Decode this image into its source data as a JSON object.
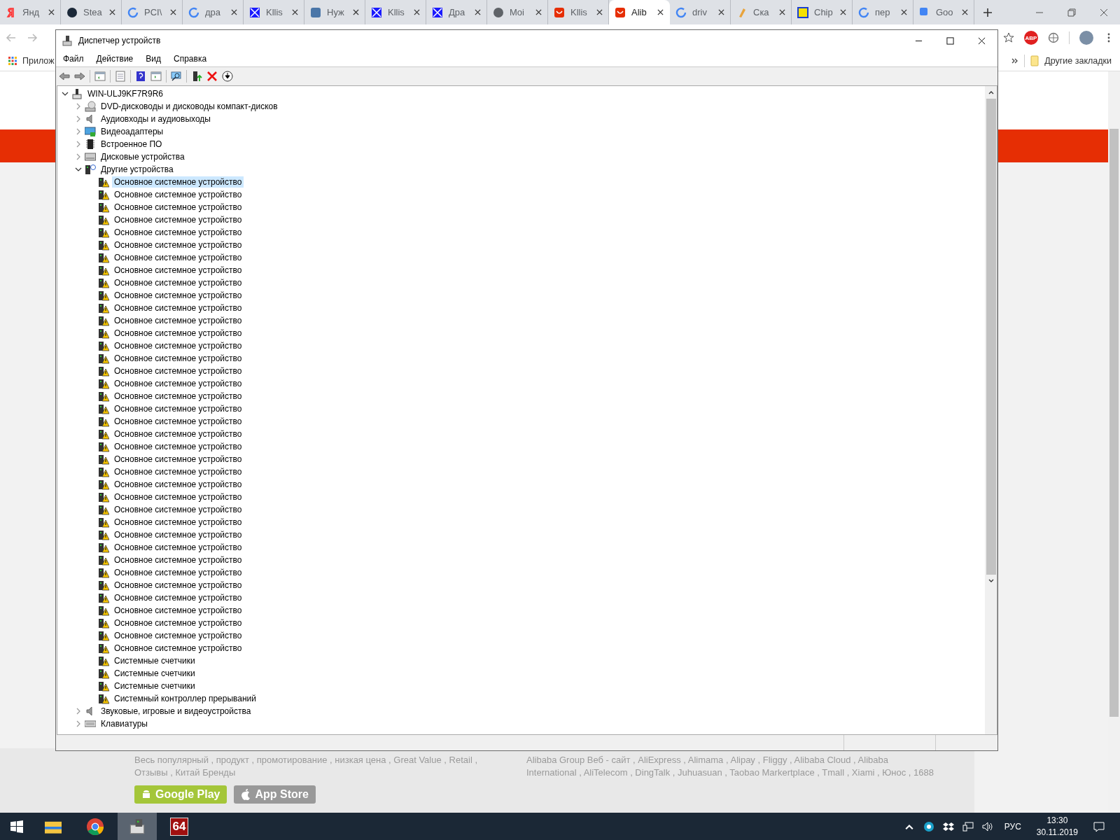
{
  "browser": {
    "tabs": [
      {
        "label": "Янд",
        "selected": false,
        "kind": "yandex"
      },
      {
        "label": "Stea",
        "selected": false,
        "kind": "steam"
      },
      {
        "label": "PCI\\",
        "selected": false,
        "kind": "google"
      },
      {
        "label": "дра",
        "selected": false,
        "kind": "google"
      },
      {
        "label": "Kllis",
        "selected": false,
        "kind": "cross"
      },
      {
        "label": "Нуж",
        "selected": false,
        "kind": "vk"
      },
      {
        "label": "Kllis",
        "selected": false,
        "kind": "cross"
      },
      {
        "label": "Дра",
        "selected": false,
        "kind": "cross"
      },
      {
        "label": "Moi",
        "selected": false,
        "kind": "globe"
      },
      {
        "label": "Kllis",
        "selected": false,
        "kind": "bag"
      },
      {
        "label": "Alib",
        "selected": true,
        "kind": "bag"
      },
      {
        "label": "driv",
        "selected": false,
        "kind": "google"
      },
      {
        "label": "Ска",
        "selected": false,
        "kind": "pencil"
      },
      {
        "label": "Chip",
        "selected": false,
        "kind": "chip"
      },
      {
        "label": "пер",
        "selected": false,
        "kind": "google"
      },
      {
        "label": "Goo",
        "selected": false,
        "kind": "translate"
      }
    ],
    "extension_badge": "ABP",
    "bookmarks": {
      "apps_label": "Прилож",
      "folder_label": "Другие закладки"
    },
    "page": {
      "left_links": [
        "Весь популярный , продукт , промотирование , низкая цена , Great Value , Retail ,",
        "Отзывы , Китай Бренды"
      ],
      "right_links": [
        "Alibaba Group Веб - сайт , AliExpress , Alimama , Alipay , Fliggy , Alibaba Cloud , Alibaba",
        "International , AliTelecom , DingTalk , Juhuasuan , Taobao Markertplace , Tmall , Xiami , Юнос , 1688"
      ],
      "store_buttons": [
        "Google Play",
        "App Store"
      ]
    }
  },
  "window": {
    "title": "Диспетчер устройств",
    "menu": [
      "Файл",
      "Действие",
      "Вид",
      "Справка"
    ],
    "tree": {
      "label": "WIN-ULJ9KF7R9R6",
      "kind": "computer",
      "expanded": true,
      "selected": false,
      "children": [
        {
          "label": "DVD-дисководы и дисководы компакт-дисков",
          "kind": "dvd",
          "expanded": false,
          "selected": false
        },
        {
          "label": "Аудиовходы и аудиовыходы",
          "kind": "audio",
          "expanded": false,
          "selected": false
        },
        {
          "label": "Видеоадаптеры",
          "kind": "display",
          "expanded": false,
          "selected": false
        },
        {
          "label": "Встроенное ПО",
          "kind": "firmware",
          "expanded": false,
          "selected": false
        },
        {
          "label": "Дисковые устройства",
          "kind": "disk",
          "expanded": false,
          "selected": false
        },
        {
          "label": "Другие устройства",
          "kind": "unknown",
          "expanded": true,
          "selected": false,
          "children": [
            {
              "label": "Основное системное устройство",
              "kind": "warning",
              "selected": true
            },
            {
              "label": "Основное системное устройство",
              "kind": "warning",
              "selected": false
            },
            {
              "label": "Основное системное устройство",
              "kind": "warning",
              "selected": false
            },
            {
              "label": "Основное системное устройство",
              "kind": "warning",
              "selected": false
            },
            {
              "label": "Основное системное устройство",
              "kind": "warning",
              "selected": false
            },
            {
              "label": "Основное системное устройство",
              "kind": "warning",
              "selected": false
            },
            {
              "label": "Основное системное устройство",
              "kind": "warning",
              "selected": false
            },
            {
              "label": "Основное системное устройство",
              "kind": "warning",
              "selected": false
            },
            {
              "label": "Основное системное устройство",
              "kind": "warning",
              "selected": false
            },
            {
              "label": "Основное системное устройство",
              "kind": "warning",
              "selected": false
            },
            {
              "label": "Основное системное устройство",
              "kind": "warning",
              "selected": false
            },
            {
              "label": "Основное системное устройство",
              "kind": "warning",
              "selected": false
            },
            {
              "label": "Основное системное устройство",
              "kind": "warning",
              "selected": false
            },
            {
              "label": "Основное системное устройство",
              "kind": "warning",
              "selected": false
            },
            {
              "label": "Основное системное устройство",
              "kind": "warning",
              "selected": false
            },
            {
              "label": "Основное системное устройство",
              "kind": "warning",
              "selected": false
            },
            {
              "label": "Основное системное устройство",
              "kind": "warning",
              "selected": false
            },
            {
              "label": "Основное системное устройство",
              "kind": "warning",
              "selected": false
            },
            {
              "label": "Основное системное устройство",
              "kind": "warning",
              "selected": false
            },
            {
              "label": "Основное системное устройство",
              "kind": "warning",
              "selected": false
            },
            {
              "label": "Основное системное устройство",
              "kind": "warning",
              "selected": false
            },
            {
              "label": "Основное системное устройство",
              "kind": "warning",
              "selected": false
            },
            {
              "label": "Основное системное устройство",
              "kind": "warning",
              "selected": false
            },
            {
              "label": "Основное системное устройство",
              "kind": "warning",
              "selected": false
            },
            {
              "label": "Основное системное устройство",
              "kind": "warning",
              "selected": false
            },
            {
              "label": "Основное системное устройство",
              "kind": "warning",
              "selected": false
            },
            {
              "label": "Основное системное устройство",
              "kind": "warning",
              "selected": false
            },
            {
              "label": "Основное системное устройство",
              "kind": "warning",
              "selected": false
            },
            {
              "label": "Основное системное устройство",
              "kind": "warning",
              "selected": false
            },
            {
              "label": "Основное системное устройство",
              "kind": "warning",
              "selected": false
            },
            {
              "label": "Основное системное устройство",
              "kind": "warning",
              "selected": false
            },
            {
              "label": "Основное системное устройство",
              "kind": "warning",
              "selected": false
            },
            {
              "label": "Основное системное устройство",
              "kind": "warning",
              "selected": false
            },
            {
              "label": "Основное системное устройство",
              "kind": "warning",
              "selected": false
            },
            {
              "label": "Основное системное устройство",
              "kind": "warning",
              "selected": false
            },
            {
              "label": "Основное системное устройство",
              "kind": "warning",
              "selected": false
            },
            {
              "label": "Основное системное устройство",
              "kind": "warning",
              "selected": false
            },
            {
              "label": "Основное системное устройство",
              "kind": "warning",
              "selected": false
            },
            {
              "label": "Системные счетчики",
              "kind": "warning",
              "selected": false
            },
            {
              "label": "Системные счетчики",
              "kind": "warning",
              "selected": false
            },
            {
              "label": "Системные счетчики",
              "kind": "warning",
              "selected": false
            },
            {
              "label": "Системный контроллер прерываний",
              "kind": "warning",
              "selected": false
            }
          ]
        },
        {
          "label": "Звуковые, игровые и видеоустройства",
          "kind": "audio",
          "expanded": false,
          "selected": false
        },
        {
          "label": "Клавиатуры",
          "kind": "keyboard",
          "expanded": false,
          "selected": false
        }
      ]
    }
  },
  "taskbar": {
    "app_badge": "64",
    "language": "РУС",
    "time": "13:30",
    "date": "30.11.2019"
  }
}
